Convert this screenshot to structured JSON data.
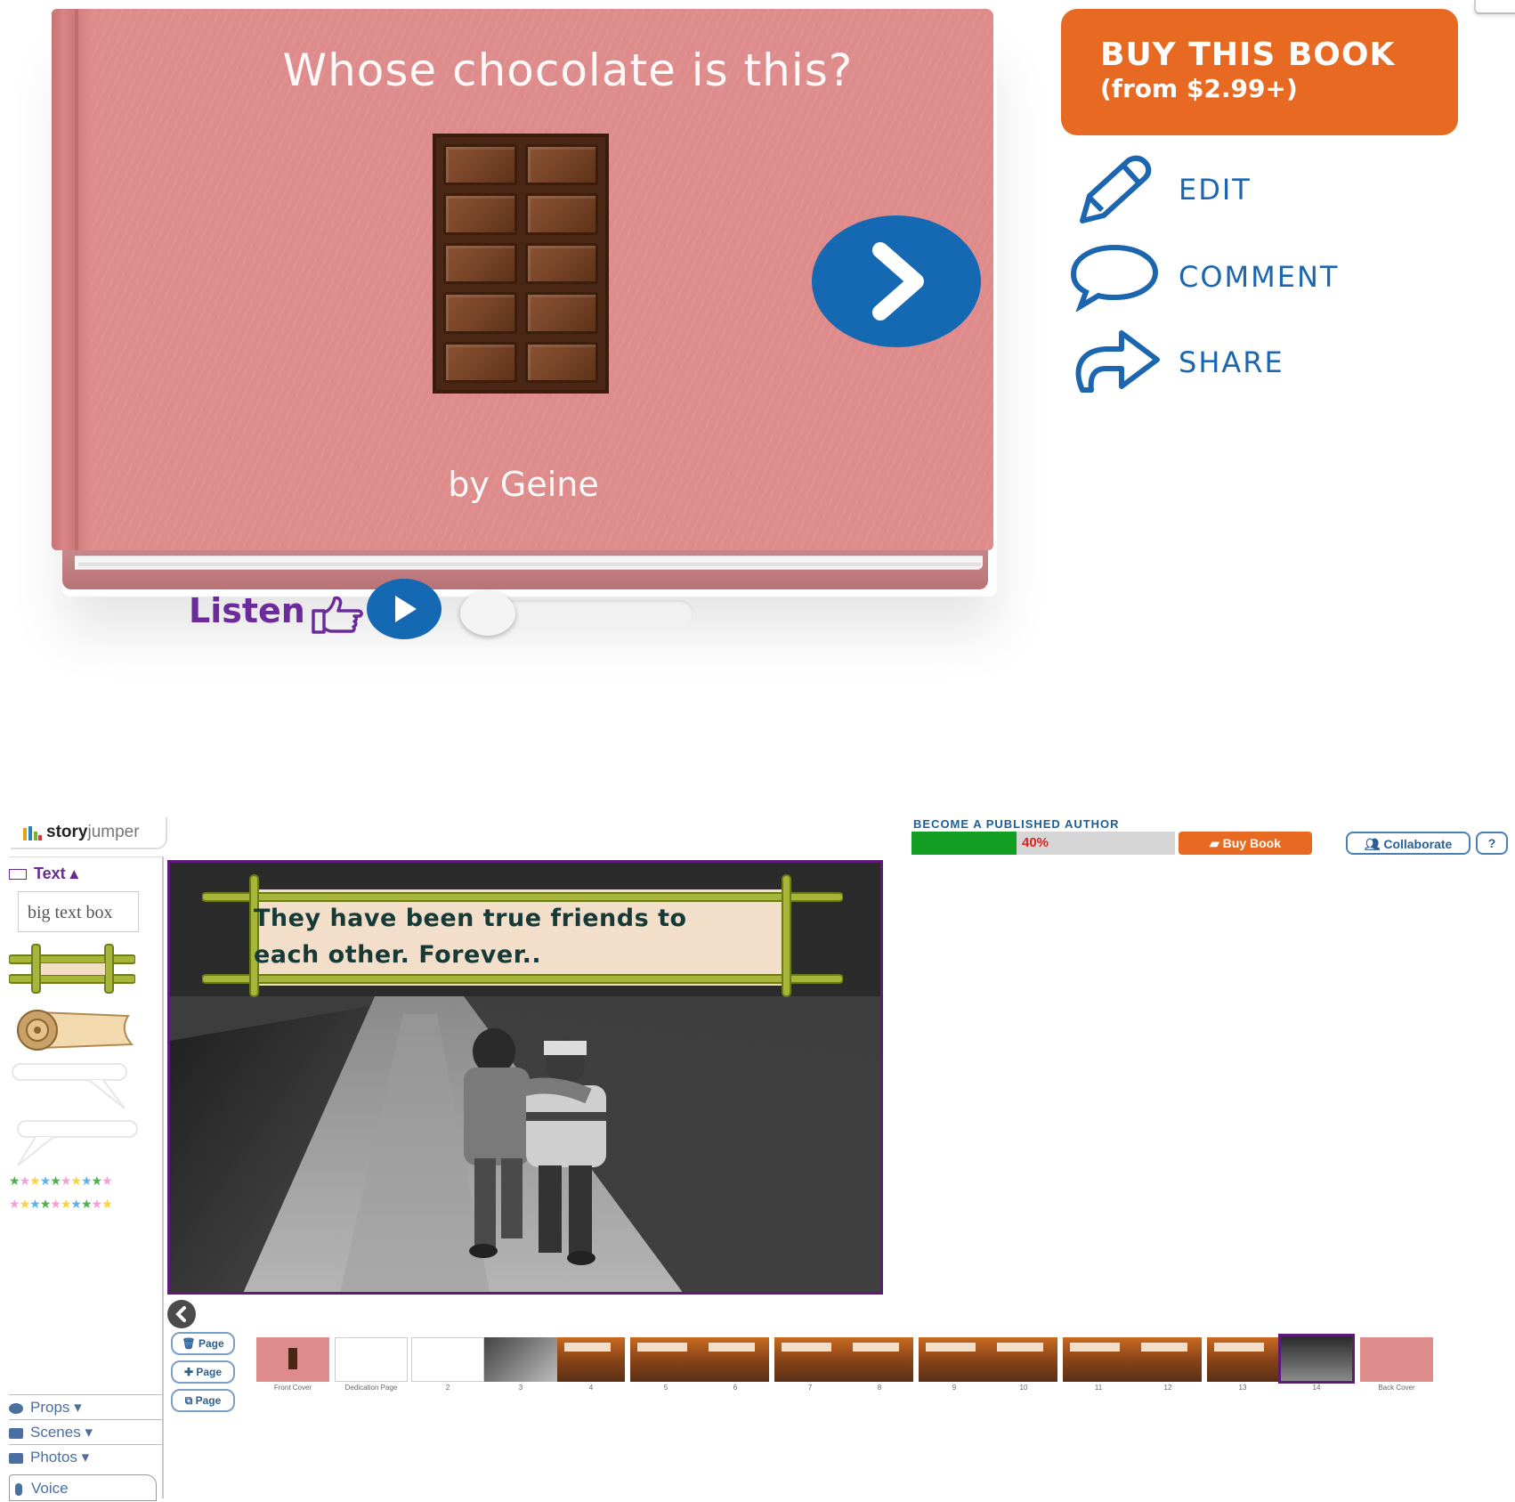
{
  "book": {
    "title": "Whose chocolate is this?",
    "author": "by Geine",
    "cover_color": "#de8b8b",
    "listen_label": "Listen",
    "listen_progress": 0
  },
  "actions": {
    "buy_line1": "BUY THIS BOOK",
    "buy_line2": "(from $2.99+)",
    "edit": "EDIT",
    "comment": "COMMENT",
    "share": "SHARE"
  },
  "colors": {
    "accent_blue": "#1569b3",
    "buy_orange": "#e86a22",
    "purple": "#6b2b9a"
  },
  "editor": {
    "logo": {
      "bold": "story",
      "light": "jumper"
    },
    "left_panel": {
      "text_tab": "Text",
      "sample_textbox": "big text box",
      "menus": [
        {
          "label": "Props",
          "icon": "props-icon"
        },
        {
          "label": "Scenes",
          "icon": "scenes-icon"
        },
        {
          "label": "Photos",
          "icon": "camera-icon"
        }
      ],
      "voice": "Voice"
    },
    "page_text": "They have been true friends to each other. Forever..",
    "published_banner": "BECOME A PUBLISHED AUTHOR",
    "progress": {
      "percent_label": "40%",
      "value": 0.4
    },
    "buy_book": "Buy Book",
    "collaborate": "Collaborate",
    "help": "?",
    "page_buttons": [
      "Page",
      "Page",
      "Page"
    ],
    "thumbnails": [
      {
        "label": "Front Cover",
        "kind": "cover"
      },
      {
        "label": "Dedication Page",
        "kind": "white"
      },
      {
        "label": "2",
        "kind": "white"
      },
      {
        "label": "3",
        "kind": "photo"
      },
      {
        "label": "4",
        "kind": "autumn"
      },
      {
        "label": "5",
        "kind": "autumn"
      },
      {
        "label": "6",
        "kind": "autumn"
      },
      {
        "label": "7",
        "kind": "autumn"
      },
      {
        "label": "8",
        "kind": "autumn"
      },
      {
        "label": "9",
        "kind": "autumn"
      },
      {
        "label": "10",
        "kind": "autumn"
      },
      {
        "label": "11",
        "kind": "autumn"
      },
      {
        "label": "12",
        "kind": "autumn"
      },
      {
        "label": "13",
        "kind": "autumn"
      },
      {
        "label": "14",
        "kind": "selected"
      },
      {
        "label": "Back Cover",
        "kind": "cover"
      }
    ]
  }
}
